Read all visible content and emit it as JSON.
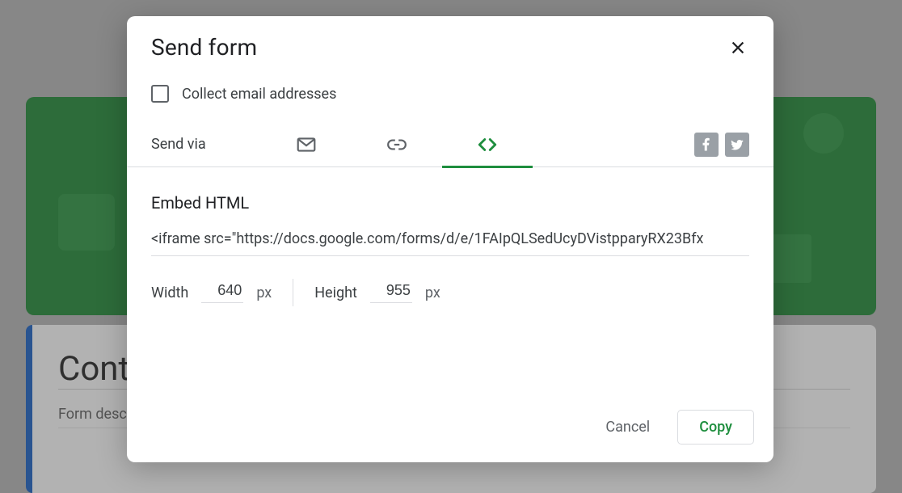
{
  "background": {
    "card_title": "Cont",
    "card_desc": "Form desc"
  },
  "dialog": {
    "title": "Send form",
    "collect_label": "Collect email addresses",
    "sendvia_label": "Send via",
    "section_title": "Embed HTML",
    "code": "<iframe src=\"https://docs.google.com/forms/d/e/1FAIpQLSedUcyDVistpparyRX23Bfx",
    "width_label": "Width",
    "width_value": "640",
    "height_label": "Height",
    "height_value": "955",
    "unit": "px",
    "cancel": "Cancel",
    "copy": "Copy"
  },
  "icons": {
    "close": "close-icon",
    "mail": "mail-icon",
    "link": "link-icon",
    "embed": "embed-icon",
    "facebook": "facebook-icon",
    "twitter": "twitter-icon"
  }
}
